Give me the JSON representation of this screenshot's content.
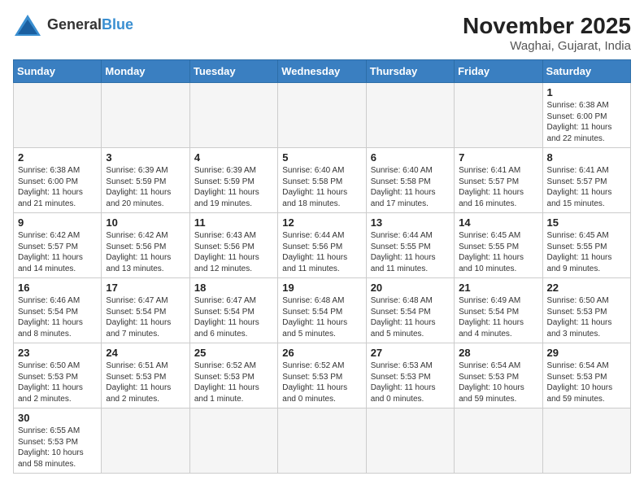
{
  "logo": {
    "text_general": "General",
    "text_blue": "Blue"
  },
  "title": "November 2025",
  "subtitle": "Waghai, Gujarat, India",
  "days_of_week": [
    "Sunday",
    "Monday",
    "Tuesday",
    "Wednesday",
    "Thursday",
    "Friday",
    "Saturday"
  ],
  "weeks": [
    [
      {
        "day": "",
        "info": ""
      },
      {
        "day": "",
        "info": ""
      },
      {
        "day": "",
        "info": ""
      },
      {
        "day": "",
        "info": ""
      },
      {
        "day": "",
        "info": ""
      },
      {
        "day": "",
        "info": ""
      },
      {
        "day": "1",
        "info": "Sunrise: 6:38 AM\nSunset: 6:00 PM\nDaylight: 11 hours and 22 minutes."
      }
    ],
    [
      {
        "day": "2",
        "info": "Sunrise: 6:38 AM\nSunset: 6:00 PM\nDaylight: 11 hours and 21 minutes."
      },
      {
        "day": "3",
        "info": "Sunrise: 6:39 AM\nSunset: 5:59 PM\nDaylight: 11 hours and 20 minutes."
      },
      {
        "day": "4",
        "info": "Sunrise: 6:39 AM\nSunset: 5:59 PM\nDaylight: 11 hours and 19 minutes."
      },
      {
        "day": "5",
        "info": "Sunrise: 6:40 AM\nSunset: 5:58 PM\nDaylight: 11 hours and 18 minutes."
      },
      {
        "day": "6",
        "info": "Sunrise: 6:40 AM\nSunset: 5:58 PM\nDaylight: 11 hours and 17 minutes."
      },
      {
        "day": "7",
        "info": "Sunrise: 6:41 AM\nSunset: 5:57 PM\nDaylight: 11 hours and 16 minutes."
      },
      {
        "day": "8",
        "info": "Sunrise: 6:41 AM\nSunset: 5:57 PM\nDaylight: 11 hours and 15 minutes."
      }
    ],
    [
      {
        "day": "9",
        "info": "Sunrise: 6:42 AM\nSunset: 5:57 PM\nDaylight: 11 hours and 14 minutes."
      },
      {
        "day": "10",
        "info": "Sunrise: 6:42 AM\nSunset: 5:56 PM\nDaylight: 11 hours and 13 minutes."
      },
      {
        "day": "11",
        "info": "Sunrise: 6:43 AM\nSunset: 5:56 PM\nDaylight: 11 hours and 12 minutes."
      },
      {
        "day": "12",
        "info": "Sunrise: 6:44 AM\nSunset: 5:56 PM\nDaylight: 11 hours and 11 minutes."
      },
      {
        "day": "13",
        "info": "Sunrise: 6:44 AM\nSunset: 5:55 PM\nDaylight: 11 hours and 11 minutes."
      },
      {
        "day": "14",
        "info": "Sunrise: 6:45 AM\nSunset: 5:55 PM\nDaylight: 11 hours and 10 minutes."
      },
      {
        "day": "15",
        "info": "Sunrise: 6:45 AM\nSunset: 5:55 PM\nDaylight: 11 hours and 9 minutes."
      }
    ],
    [
      {
        "day": "16",
        "info": "Sunrise: 6:46 AM\nSunset: 5:54 PM\nDaylight: 11 hours and 8 minutes."
      },
      {
        "day": "17",
        "info": "Sunrise: 6:47 AM\nSunset: 5:54 PM\nDaylight: 11 hours and 7 minutes."
      },
      {
        "day": "18",
        "info": "Sunrise: 6:47 AM\nSunset: 5:54 PM\nDaylight: 11 hours and 6 minutes."
      },
      {
        "day": "19",
        "info": "Sunrise: 6:48 AM\nSunset: 5:54 PM\nDaylight: 11 hours and 5 minutes."
      },
      {
        "day": "20",
        "info": "Sunrise: 6:48 AM\nSunset: 5:54 PM\nDaylight: 11 hours and 5 minutes."
      },
      {
        "day": "21",
        "info": "Sunrise: 6:49 AM\nSunset: 5:54 PM\nDaylight: 11 hours and 4 minutes."
      },
      {
        "day": "22",
        "info": "Sunrise: 6:50 AM\nSunset: 5:53 PM\nDaylight: 11 hours and 3 minutes."
      }
    ],
    [
      {
        "day": "23",
        "info": "Sunrise: 6:50 AM\nSunset: 5:53 PM\nDaylight: 11 hours and 2 minutes."
      },
      {
        "day": "24",
        "info": "Sunrise: 6:51 AM\nSunset: 5:53 PM\nDaylight: 11 hours and 2 minutes."
      },
      {
        "day": "25",
        "info": "Sunrise: 6:52 AM\nSunset: 5:53 PM\nDaylight: 11 hours and 1 minute."
      },
      {
        "day": "26",
        "info": "Sunrise: 6:52 AM\nSunset: 5:53 PM\nDaylight: 11 hours and 0 minutes."
      },
      {
        "day": "27",
        "info": "Sunrise: 6:53 AM\nSunset: 5:53 PM\nDaylight: 11 hours and 0 minutes."
      },
      {
        "day": "28",
        "info": "Sunrise: 6:54 AM\nSunset: 5:53 PM\nDaylight: 10 hours and 59 minutes."
      },
      {
        "day": "29",
        "info": "Sunrise: 6:54 AM\nSunset: 5:53 PM\nDaylight: 10 hours and 59 minutes."
      }
    ],
    [
      {
        "day": "30",
        "info": "Sunrise: 6:55 AM\nSunset: 5:53 PM\nDaylight: 10 hours and 58 minutes."
      },
      {
        "day": "",
        "info": ""
      },
      {
        "day": "",
        "info": ""
      },
      {
        "day": "",
        "info": ""
      },
      {
        "day": "",
        "info": ""
      },
      {
        "day": "",
        "info": ""
      },
      {
        "day": "",
        "info": ""
      }
    ]
  ]
}
